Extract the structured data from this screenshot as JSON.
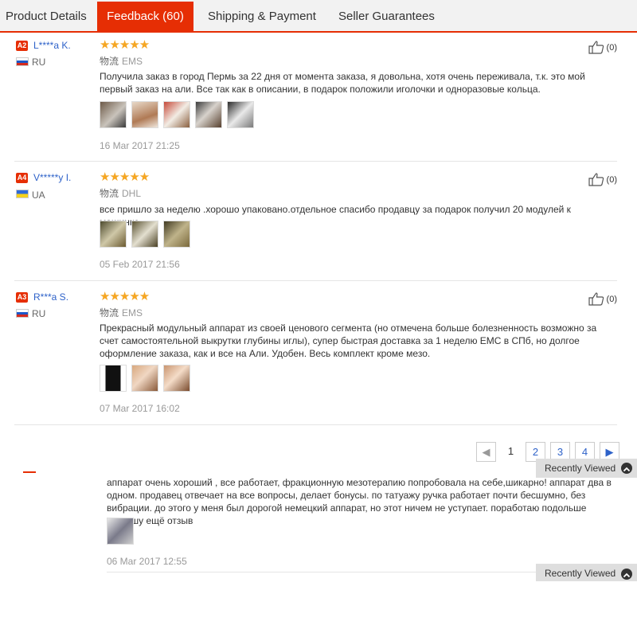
{
  "tabs": [
    {
      "label": "Product Details"
    },
    {
      "label": "Feedback (60)"
    },
    {
      "label": "Shipping & Payment"
    },
    {
      "label": "Seller Guarantees"
    }
  ],
  "reviews": [
    {
      "level": "A2",
      "username": "L****a K.",
      "country": "RU",
      "flag": "ru",
      "stars": "★★★★★",
      "rating": 5,
      "shipping_label": "物流",
      "carrier": "EMS",
      "text": "Получила заказ в город Пермь за 22 дня от момента заказа, я довольна, хотя очень переживала, т.к. это мой первый заказ на али. Все так как в описании, в подарок положили иголочки и одноразовые кольца.",
      "date": "16 Mar 2017 21:25",
      "helpful": "(0)",
      "photos": 5
    },
    {
      "level": "A4",
      "username": "V*****y I.",
      "country": "UA",
      "flag": "ua",
      "stars": "★★★★★",
      "rating": 5,
      "shipping_label": "物流",
      "carrier": "DHL",
      "text": "все пришло за неделю .хорошо упаковано.отдельное спасибо продавцу за подарок получил 20 модулей к машинке",
      "date": "05 Feb 2017 21:56",
      "helpful": "(0)",
      "photos": 3
    },
    {
      "level": "A3",
      "username": "R***a S.",
      "country": "RU",
      "flag": "ru",
      "stars": "★★★★★",
      "rating": 5,
      "shipping_label": "物流",
      "carrier": "EMS",
      "text": "Прекрасный модульный аппарат из своей ценового сегмента (но отмечена больше болезненность возможно за счет самостоятельной выкрутки глубины иглы), супер быстрая доставка за 1 неделю ЕМС в СПб, но долгое оформление заказа, как и все на Али. Удобен. Весь комплект кроме мезо.",
      "date": "07 Mar 2017 16:02",
      "helpful": "(0)",
      "photos": 3
    }
  ],
  "pagination": {
    "prev": "◀",
    "pages": [
      "1",
      "2",
      "3",
      "4"
    ],
    "current": "1",
    "next": "▶"
  },
  "recently_viewed": {
    "label": "Recently Viewed"
  },
  "lower_review": {
    "text": "аппарат очень хороший , все работает, фракционную мезотерапию попробовала на себе,шикарно! аппарат два в одном. продавец отвечает на все вопросы, делает бонусы. по татуажу ручка работает почти бесшумно, без вибрации. до этого у меня был дорогой немецкий аппарат, но этот ничем не уступает. поработаю подольше -напишу ещё отзыв",
    "date": "06 Mar 2017 12:55",
    "photos": 1
  },
  "colors": {
    "accent": "#e62e04",
    "link": "#2e62c9",
    "star": "#f5a623"
  }
}
